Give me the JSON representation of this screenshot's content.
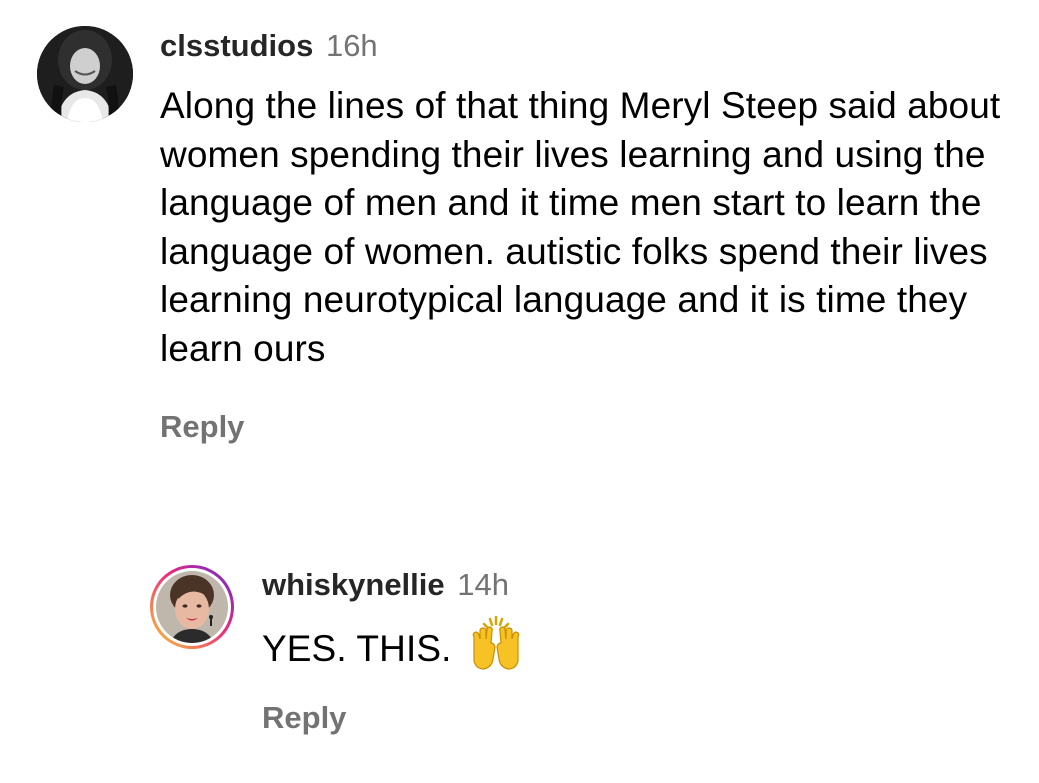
{
  "comments": [
    {
      "username": "clsstudios",
      "timestamp": "16h",
      "text": "Along the lines of that thing Meryl Steep said about women spending their lives learning and using the language of men and it time men start to learn the language of women. autistic folks spend their lives learning neurotypical language and it is time they learn ours",
      "reply_label": "Reply",
      "avatar": "profile-photo"
    }
  ],
  "replies": [
    {
      "username": "whiskynellie",
      "timestamp": "14h",
      "text": "YES. THIS.",
      "emoji": "raising-hands-emoji",
      "reply_label": "Reply",
      "avatar": "profile-photo-with-story-ring"
    }
  ],
  "colors": {
    "username": "#262626",
    "secondary_text": "#737373",
    "story_ring_start": "#f9ce34",
    "story_ring_mid": "#ee2a7b",
    "story_ring_end": "#6228d7"
  }
}
